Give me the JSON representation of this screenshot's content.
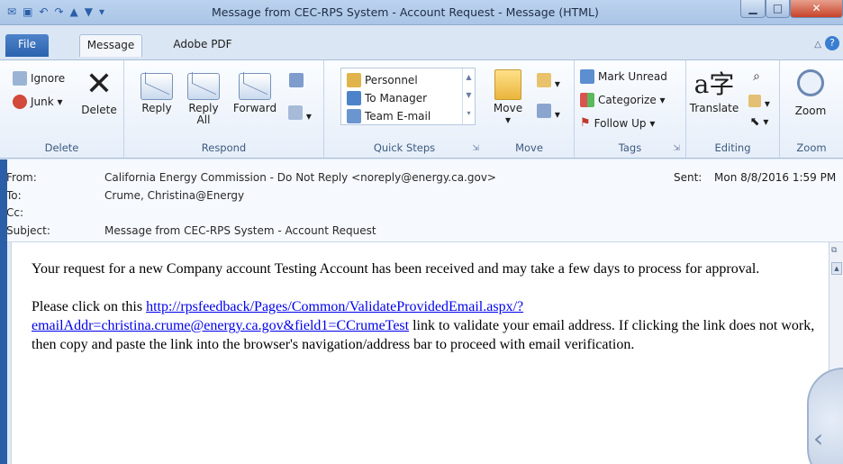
{
  "window": {
    "title": "Message from CEC-RPS System - Account Request  -  Message (HTML)",
    "minimize_glyph": "▁",
    "maximize_glyph": "□",
    "close_glyph": "✕"
  },
  "tabs": {
    "file": "File",
    "message": "Message",
    "adobe": "Adobe PDF"
  },
  "ribbon": {
    "delete_group": {
      "ignore": "Ignore",
      "junk": "Junk ▾",
      "delete": "Delete",
      "label": "Delete"
    },
    "respond_group": {
      "reply": "Reply",
      "reply_all_line1": "Reply",
      "reply_all_line2": "All",
      "forward": "Forward",
      "label": "Respond"
    },
    "quick_steps": {
      "items": [
        "Personnel",
        "To Manager",
        "Team E-mail"
      ],
      "label": "Quick Steps"
    },
    "move_group": {
      "move": "Move",
      "label": "Move"
    },
    "tags_group": {
      "mark_unread": "Mark Unread",
      "categorize": "Categorize ▾",
      "follow_up": "Follow Up ▾",
      "label": "Tags"
    },
    "editing_group": {
      "translate": "Translate",
      "label": "Editing"
    },
    "zoom_group": {
      "zoom": "Zoom",
      "label": "Zoom"
    }
  },
  "header": {
    "from_label": "From:",
    "from_value": "California Energy Commission - Do Not Reply <noreply@energy.ca.gov>",
    "to_label": "To:",
    "to_value": "Crume, Christina@Energy",
    "cc_label": "Cc:",
    "cc_value": "",
    "subject_label": "Subject:",
    "subject_value": "Message from CEC-RPS System - Account Request",
    "sent_label": "Sent:",
    "sent_value": "Mon 8/8/2016 1:59 PM"
  },
  "body": {
    "para1": "Your request for a new Company account Testing Account has been received and may take a few days to process for approval.",
    "para2_prefix": "Please click on this ",
    "link_line1": "http://rpsfeedback/Pages/Common/ValidateProvidedEmail.aspx/?",
    "link_line2": "emailAddr=christina.crume@energy.ca.gov&field1=CCrumeTest",
    "para2_suffix": " link to validate your email address. If clicking the link does not work, then copy and paste the link into the browser's navigation/address bar to proceed with email verification."
  },
  "colors": {
    "file_tab": "#2b63ad",
    "link": "#0000ee",
    "close_button": "#c7432a"
  }
}
